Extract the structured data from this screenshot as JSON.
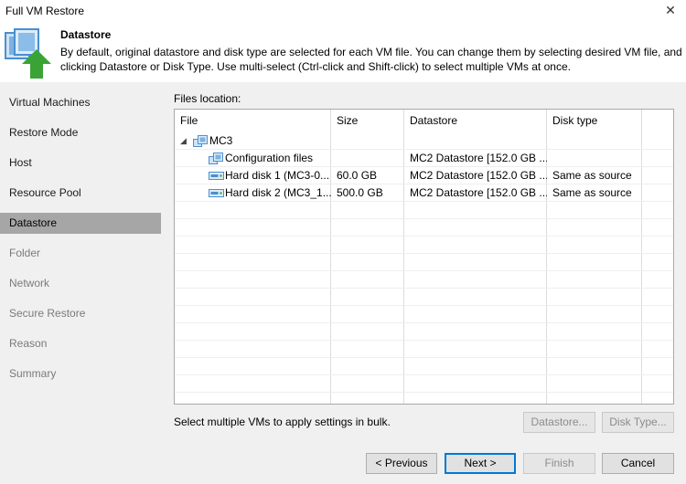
{
  "window": {
    "title": "Full VM Restore",
    "close_glyph": "✕"
  },
  "header": {
    "title": "Datastore",
    "description": "By default, original datastore and disk type are selected for each VM file. You can change them by selecting desired VM file, and clicking Datastore or Disk Type. Use multi-select (Ctrl-click and Shift-click) to select multiple VMs at once.",
    "icon": "restore-arrow-icon"
  },
  "sidebar": {
    "items": [
      {
        "label": "Virtual Machines",
        "state": "normal"
      },
      {
        "label": "Restore Mode",
        "state": "normal"
      },
      {
        "label": "Host",
        "state": "normal"
      },
      {
        "label": "Resource Pool",
        "state": "normal"
      },
      {
        "label": "Datastore",
        "state": "active"
      },
      {
        "label": "Folder",
        "state": "disabled"
      },
      {
        "label": "Network",
        "state": "disabled"
      },
      {
        "label": "Secure Restore",
        "state": "disabled"
      },
      {
        "label": "Reason",
        "state": "disabled"
      },
      {
        "label": "Summary",
        "state": "disabled"
      }
    ]
  },
  "files": {
    "label": "Files location:",
    "columns": [
      "File",
      "Size",
      "Datastore",
      "Disk type"
    ],
    "expand_glyph": "◢",
    "vm": {
      "name": "MC3",
      "icon": "vm-icon"
    },
    "rows": [
      {
        "file": "Configuration files",
        "size": "",
        "datastore": "MC2 Datastore [152.0 GB ...",
        "disk_type": "",
        "icon": "config-files-icon"
      },
      {
        "file": "Hard disk 1 (MC3-0...",
        "size": "60.0 GB",
        "datastore": "MC2 Datastore [152.0 GB ...",
        "disk_type": "Same as source",
        "icon": "hard-disk-icon"
      },
      {
        "file": "Hard disk 2 (MC3_1...",
        "size": "500.0 GB",
        "datastore": "MC2 Datastore [152.0 GB ...",
        "disk_type": "Same as source",
        "icon": "hard-disk-icon"
      }
    ]
  },
  "bulk_text": "Select multiple VMs to apply settings in bulk.",
  "buttons": {
    "datastore": "Datastore...",
    "disk_type": "Disk Type...",
    "previous": "< Previous",
    "next": "Next >",
    "finish": "Finish",
    "cancel": "Cancel"
  },
  "colors": {
    "active_item": "#a6a6a6",
    "panel_bg": "#f0f0f0",
    "icon_blue": "#4a8fd0",
    "arrow_green": "#3aa335",
    "default_button_border": "#0078d7"
  }
}
